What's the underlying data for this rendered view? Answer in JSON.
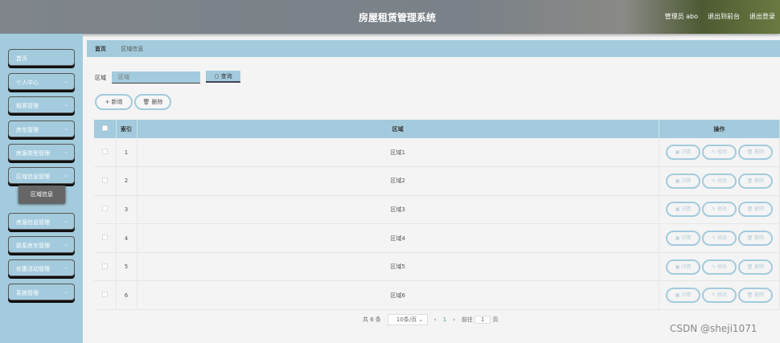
{
  "header": {
    "title": "房屋租赁管理系统",
    "user": "管理员 abo",
    "to_front": "退出到前台",
    "logout": "退出登录"
  },
  "sidebar": {
    "items": [
      {
        "label": "首页"
      },
      {
        "label": "个人中心"
      },
      {
        "label": "租客管理"
      },
      {
        "label": "房东管理"
      },
      {
        "label": "房源类型管理"
      },
      {
        "label": "区域信息管理"
      },
      {
        "label": "房源信息管理"
      },
      {
        "label": "联系房东管理"
      },
      {
        "label": "优惠活动管理"
      },
      {
        "label": "系统管理"
      }
    ],
    "active_sub": "区域信息"
  },
  "breadcrumb": {
    "home": "首页",
    "current": "区域信息"
  },
  "search": {
    "label": "区域",
    "placeholder": "区域",
    "button": "查询"
  },
  "actions": {
    "add": "新增",
    "delete": "删除"
  },
  "table": {
    "headers": {
      "index": "索引",
      "region": "区域",
      "ops": "操作"
    },
    "rows": [
      {
        "index": "1",
        "region": "区域1"
      },
      {
        "index": "2",
        "region": "区域2"
      },
      {
        "index": "3",
        "region": "区域3"
      },
      {
        "index": "4",
        "region": "区域4"
      },
      {
        "index": "5",
        "region": "区域5"
      },
      {
        "index": "6",
        "region": "区域6"
      }
    ],
    "row_actions": {
      "detail": "详情",
      "edit": "修改",
      "delete": "删除"
    }
  },
  "pagination": {
    "total": "共 6 条",
    "page_size": "10条/页",
    "current": "1",
    "goto_label": "前往",
    "goto_value": "1",
    "page_unit": "页"
  },
  "watermark": "CSDN @sheji1071"
}
